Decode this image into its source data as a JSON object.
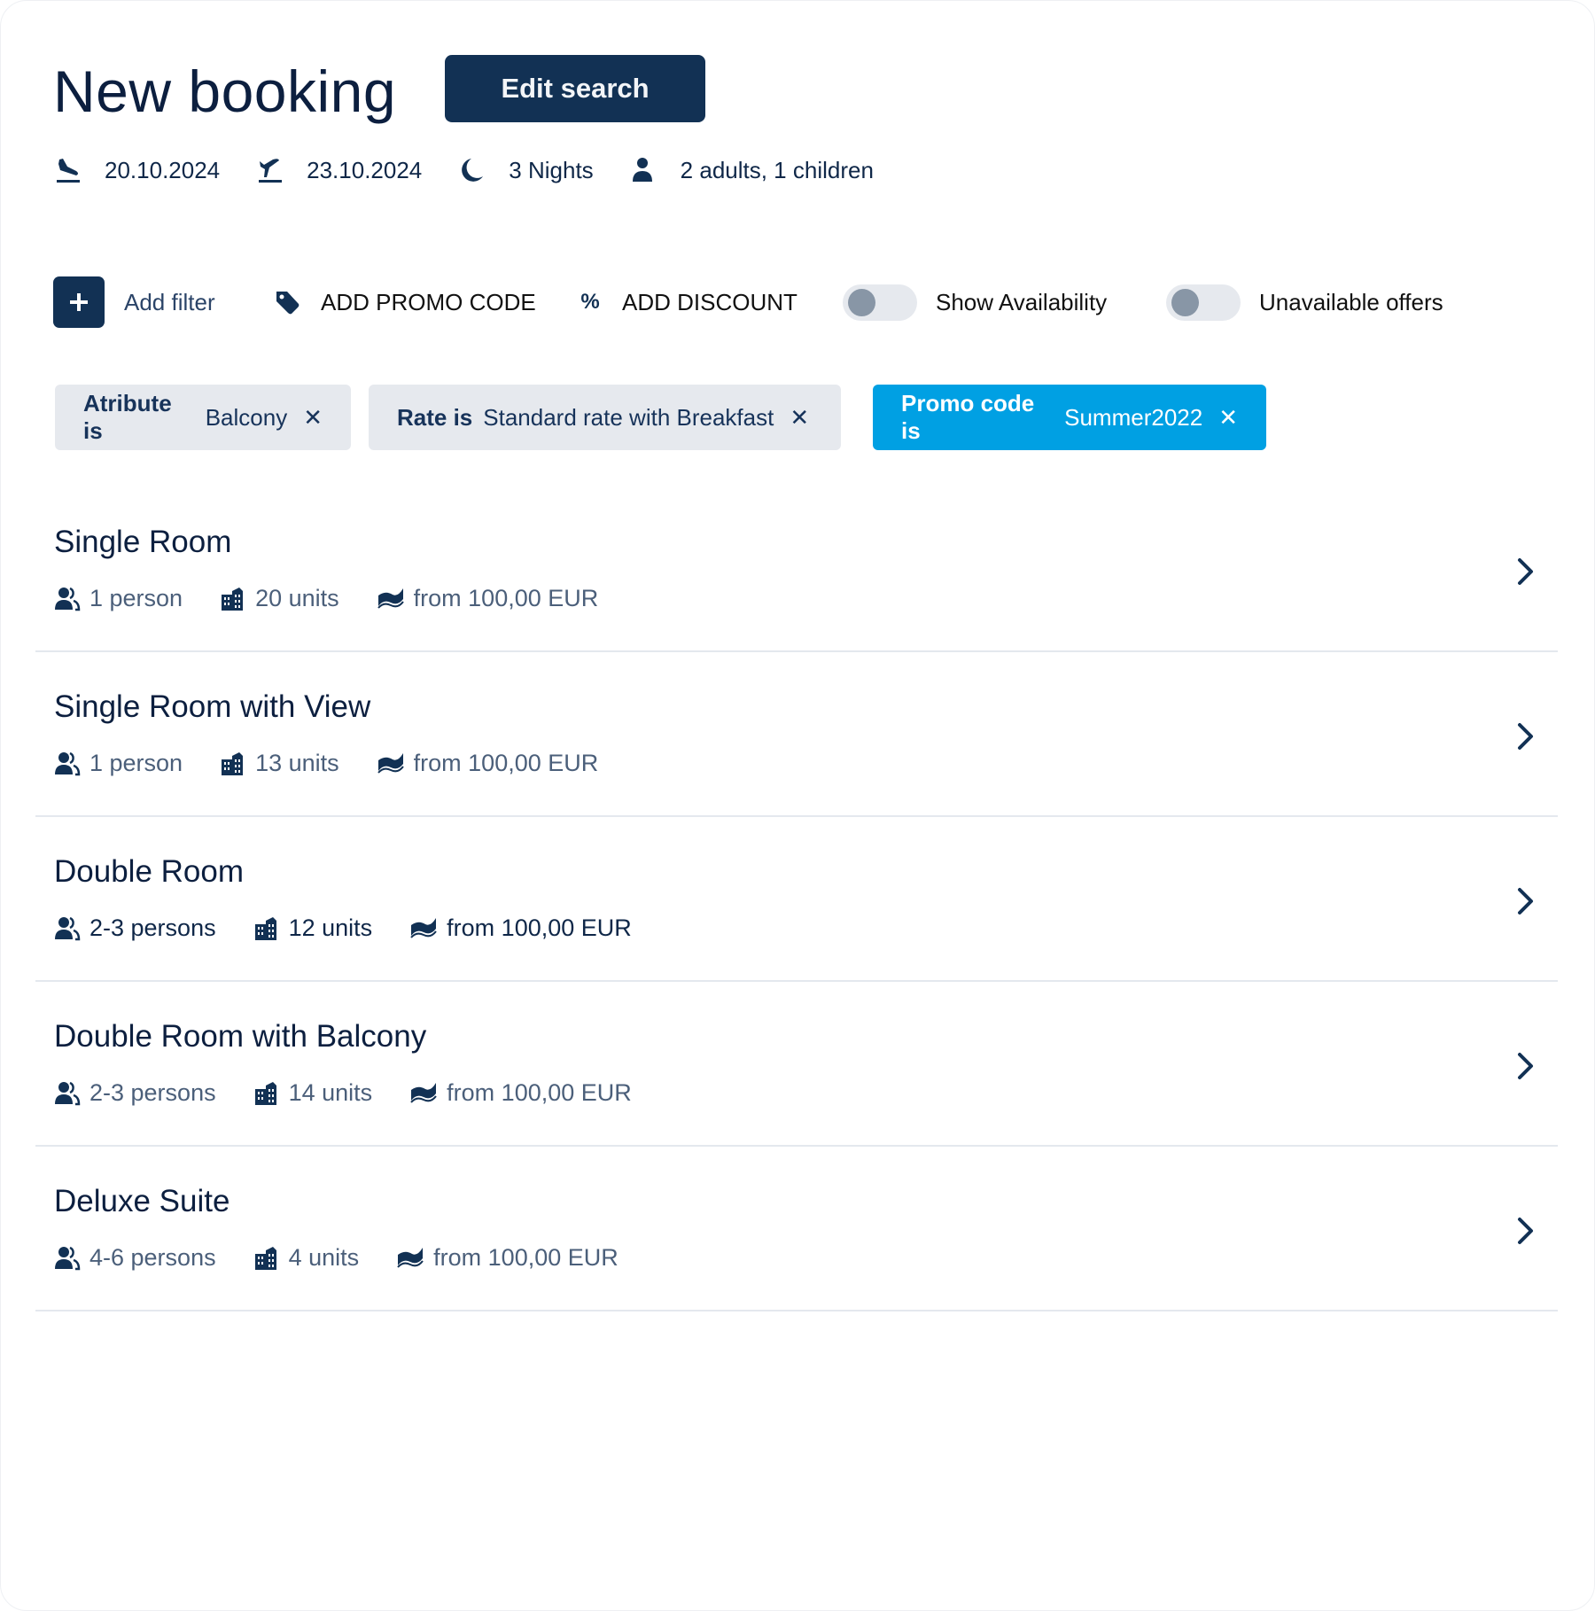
{
  "header": {
    "title": "New booking",
    "edit_search_label": "Edit search"
  },
  "summary": {
    "arrival": {
      "icon": "plane-landing-icon",
      "label": "20.10.2024"
    },
    "departure": {
      "icon": "plane-departure-icon",
      "label": "23.10.2024"
    },
    "nights": {
      "icon": "moon-icon",
      "label": "3 Nights"
    },
    "guests": {
      "icon": "person-icon",
      "label": "2 adults, 1 children"
    }
  },
  "toolbar": {
    "add_filter_label": "Add filter",
    "promo_label": "ADD PROMO CODE",
    "discount_icon": "%",
    "discount_label": "ADD DISCOUNT",
    "show_availability": {
      "label": "Show Availability",
      "on": false
    },
    "unavailable_offers": {
      "label": "Unavailable offers",
      "on": false
    }
  },
  "filters": [
    {
      "key": "Atribute is",
      "value": "Balcony",
      "style": "gray"
    },
    {
      "key": "Rate is",
      "value": "Standard rate with Breakfast",
      "style": "gray"
    },
    {
      "key": "Promo code is",
      "value": "Summer2022",
      "style": "blue"
    }
  ],
  "colors": {
    "primary": "#123154",
    "accent": "#00a0e3",
    "chip_gray": "#e6e9ee",
    "meta_text": "#4b5f7a"
  },
  "rooms": [
    {
      "name": "Single Room",
      "persons": "1 person",
      "units": "20 units",
      "price": "from 100,00 EUR",
      "active": false
    },
    {
      "name": "Single Room with View",
      "persons": "1 person",
      "units": "13 units",
      "price": "from 100,00 EUR",
      "active": false
    },
    {
      "name": "Double Room",
      "persons": "2-3 persons",
      "units": "12 units",
      "price": "from 100,00 EUR",
      "active": true
    },
    {
      "name": "Double Room with Balcony",
      "persons": "2-3 persons",
      "units": "14 units",
      "price": "from 100,00 EUR",
      "active": false
    },
    {
      "name": "Deluxe Suite",
      "persons": "4-6 persons",
      "units": "4 units",
      "price": "from 100,00 EUR",
      "active": false
    }
  ]
}
